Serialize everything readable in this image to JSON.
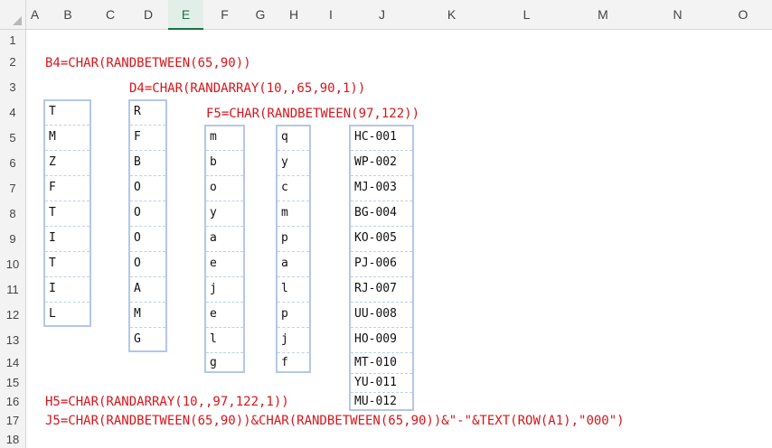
{
  "column_headers": [
    "A",
    "B",
    "C",
    "D",
    "E",
    "F",
    "G",
    "H",
    "I",
    "J",
    "K",
    "L",
    "M",
    "N",
    "O"
  ],
  "row_headers": [
    "1",
    "2",
    "3",
    "4",
    "5",
    "6",
    "7",
    "8",
    "9",
    "10",
    "11",
    "12",
    "13",
    "14",
    "15",
    "16",
    "17",
    "18"
  ],
  "formulas": {
    "b4": "B4=CHAR(RANDBETWEEN(65,90))",
    "d4": "D4=CHAR(RANDARRAY(10,,65,90,1))",
    "f5": "F5=CHAR(RANDBETWEEN(97,122))",
    "h5": "H5=CHAR(RANDARRAY(10,,97,122,1))",
    "j5": "J5=CHAR(RANDBETWEEN(65,90))&CHAR(RANDBETWEEN(65,90))&\"-\"&TEXT(ROW(A1),\"000\")"
  },
  "columns": {
    "B": [
      "T",
      "M",
      "Z",
      "F",
      "T",
      "I",
      "T",
      "I",
      "L"
    ],
    "D": [
      "R",
      "F",
      "B",
      "O",
      "O",
      "O",
      "O",
      "A",
      "M",
      "G"
    ],
    "F": [
      "m",
      "b",
      "o",
      "y",
      "a",
      "e",
      "j",
      "e",
      "l",
      "g"
    ],
    "H": [
      "q",
      "y",
      "c",
      "m",
      "p",
      "a",
      "l",
      "p",
      "j",
      "f"
    ],
    "J": [
      "HC-001",
      "WP-002",
      "MJ-003",
      "BG-004",
      "KO-005",
      "PJ-006",
      "RJ-007",
      "UU-008",
      "HO-009",
      "MT-010",
      "YU-011",
      "MU-012"
    ]
  },
  "selected_column": "E",
  "colors": {
    "formula": "#d9151b",
    "selection": "#b4c7e7",
    "header_selected": "#1e7145"
  }
}
